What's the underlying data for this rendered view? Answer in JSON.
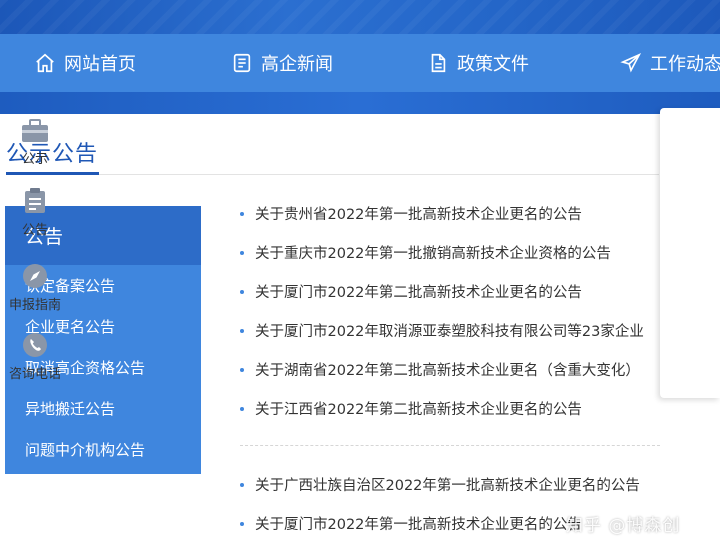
{
  "nav": {
    "items": [
      {
        "label": "网站首页",
        "icon": "home-icon"
      },
      {
        "label": "高企新闻",
        "icon": "news-icon"
      },
      {
        "label": "政策文件",
        "icon": "document-icon"
      },
      {
        "label": "工作动态",
        "icon": "paper-plane-icon"
      }
    ]
  },
  "section": {
    "title": "公示公告"
  },
  "sidebar": {
    "header": "公告",
    "items": [
      {
        "label": "认定备案公告"
      },
      {
        "label": "企业更名公告"
      },
      {
        "label": "取消高企资格公告"
      },
      {
        "label": "异地搬迁公告"
      },
      {
        "label": "问题中介机构公告"
      }
    ]
  },
  "news": {
    "group1": [
      {
        "title": "关于贵州省2022年第一批高新技术企业更名的公告"
      },
      {
        "title": "关于重庆市2022年第一批撤销高新技术企业资格的公告"
      },
      {
        "title": "关于厦门市2022年第二批高新技术企业更名的公告"
      },
      {
        "title": "关于厦门市2022年取消源亚泰塑胶科技有限公司等23家企业"
      },
      {
        "title": "关于湖南省2022年第二批高新技术企业更名（含重大变化）"
      },
      {
        "title": "关于江西省2022年第二批高新技术企业更名的公告"
      }
    ],
    "group2": [
      {
        "title": "关于广西壮族自治区2022年第一批高新技术企业更名的公告"
      },
      {
        "title": "关于厦门市2022年第一批高新技术企业更名的公告"
      }
    ]
  },
  "float_panel": {
    "items": [
      {
        "label": "公示",
        "icon": "briefcase-icon"
      },
      {
        "label": "公告",
        "icon": "clipboard-icon"
      },
      {
        "label": "申报指南",
        "icon": "compass-icon"
      },
      {
        "label": "咨询电话",
        "icon": "phone-icon"
      }
    ]
  },
  "watermark": {
    "text": "知乎 @博森创"
  },
  "colors": {
    "nav_blue": "#3f86de",
    "title_blue": "#1f57b5",
    "sidebar_header": "#2d6cc8"
  }
}
